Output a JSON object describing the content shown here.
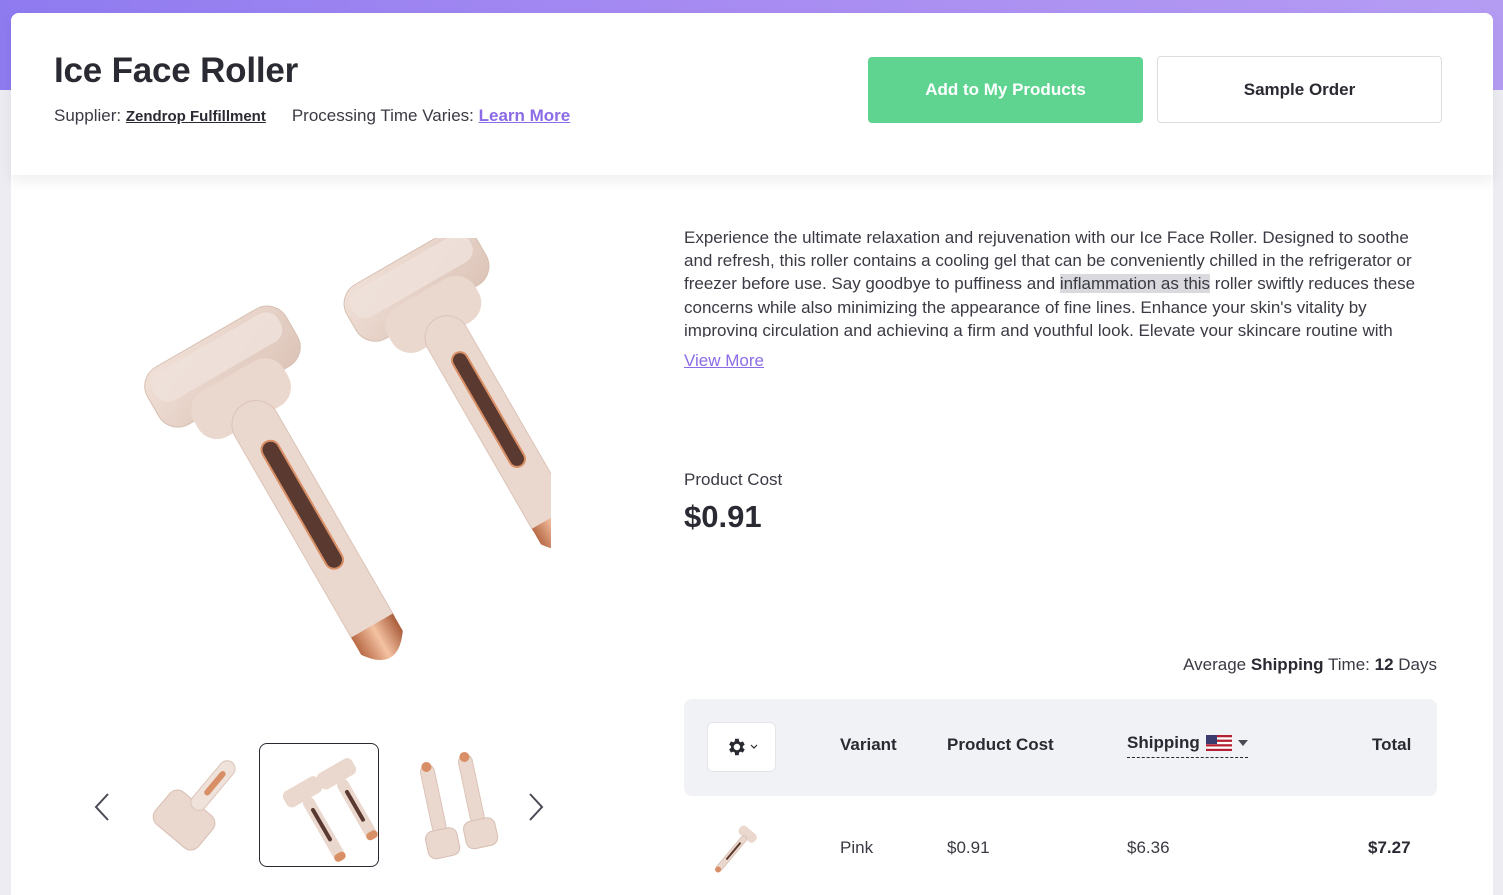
{
  "product": {
    "title": "Ice Face Roller",
    "supplier_label": "Supplier:",
    "supplier_name": "Zendrop Fulfillment",
    "processing_label": "Processing Time Varies:",
    "processing_link": "Learn More"
  },
  "actions": {
    "add_label": "Add to My Products",
    "sample_label": "Sample Order"
  },
  "description": {
    "before": "Experience the ultimate relaxation and rejuvenation with our Ice Face Roller. Designed to soothe and refresh, this roller contains a cooling gel that can be conveniently chilled in the refrigerator or freezer before use. Say goodbye to puffiness and ",
    "highlight": "inflammation as this",
    "after": " roller swiftly reduces these concerns while also minimizing the appearance of fine lines. Enhance your skin's vitality by improving circulation and achieving a firm and youthful look. Elevate your skincare routine with",
    "view_more": "View More"
  },
  "pricing": {
    "cost_label": "Product Cost",
    "cost_value": "$0.91"
  },
  "shipping_time": {
    "prefix": "Average",
    "bold_word": "Shipping",
    "middle": "Time:",
    "days_value": "12",
    "days_unit": "Days"
  },
  "table": {
    "headers": {
      "variant": "Variant",
      "product_cost": "Product Cost",
      "shipping": "Shipping",
      "total": "Total"
    },
    "rows": [
      {
        "variant": "Pink",
        "product_cost": "$0.91",
        "shipping": "$6.36",
        "total": "$7.27"
      }
    ]
  },
  "gallery": {
    "active_index": 1,
    "thumb_count": 3
  },
  "colors": {
    "accent_green": "#5fd491",
    "link_purple": "#8b6ce6",
    "product_pink": "#ead7cd",
    "rose_gold": "#d98f66",
    "header_gradient": "#a88cf2"
  },
  "icons": {
    "gear": "gear-icon",
    "prev": "chevron-left-icon",
    "next": "chevron-right-icon",
    "flag": "us-flag-icon",
    "caret": "caret-down-icon"
  }
}
